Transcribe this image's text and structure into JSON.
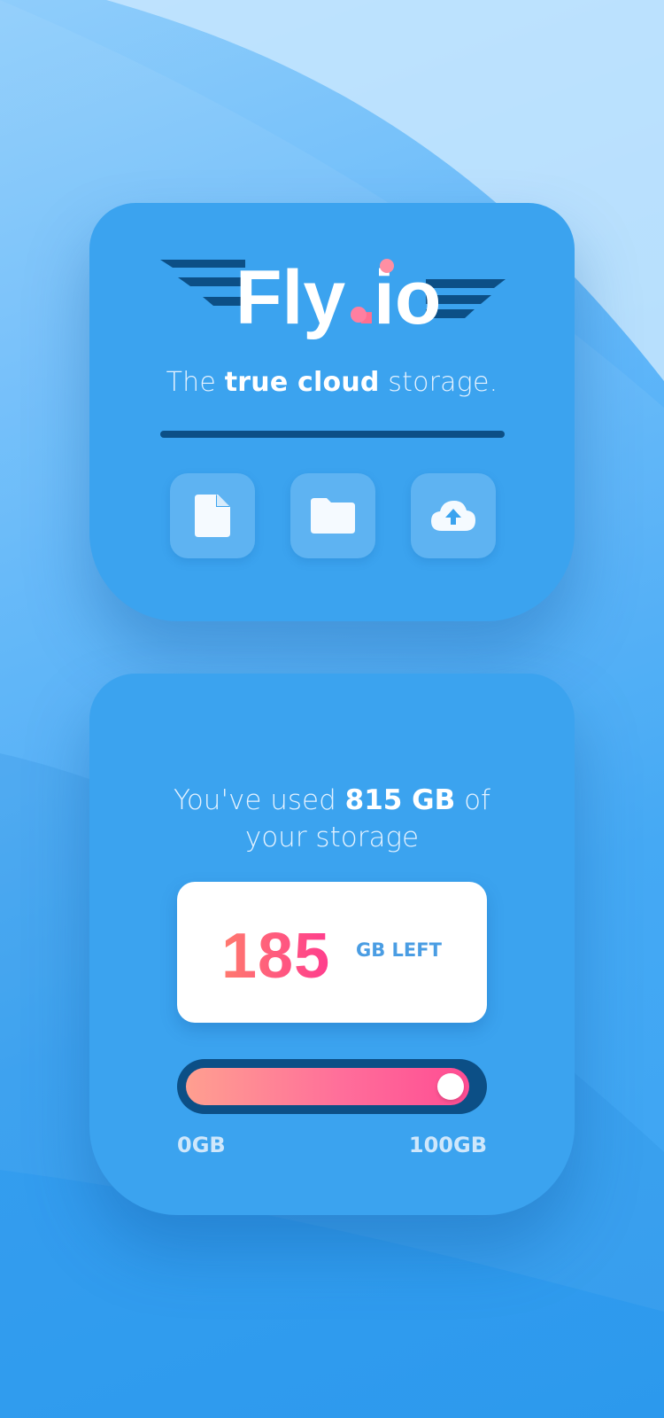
{
  "brand": {
    "name_part1": "Fly",
    "name_dot": ".",
    "name_part2": "io",
    "logo_color": "#ffffff",
    "accent_color": "#ff6f91",
    "wing_color": "#0c4f86"
  },
  "tagline": {
    "prefix": "The ",
    "emphasis": "true cloud",
    "suffix": " storage."
  },
  "actions": [
    {
      "icon": "file-icon"
    },
    {
      "icon": "folder-icon"
    },
    {
      "icon": "cloud-upload-icon"
    }
  ],
  "usage": {
    "prefix": "You've used ",
    "amount": "815 GB",
    "suffix_line1": " of",
    "line2": "your storage"
  },
  "remaining": {
    "number": "185",
    "label": "GB LEFT"
  },
  "slider": {
    "fill_fraction": 0.97,
    "min_label": "0GB",
    "max_label": "100GB"
  },
  "colors": {
    "card": "#3ba3ef",
    "divider": "#0c4f86",
    "number_gradient_start": "#ff7a6e",
    "number_gradient_end": "#ff3d8e"
  }
}
